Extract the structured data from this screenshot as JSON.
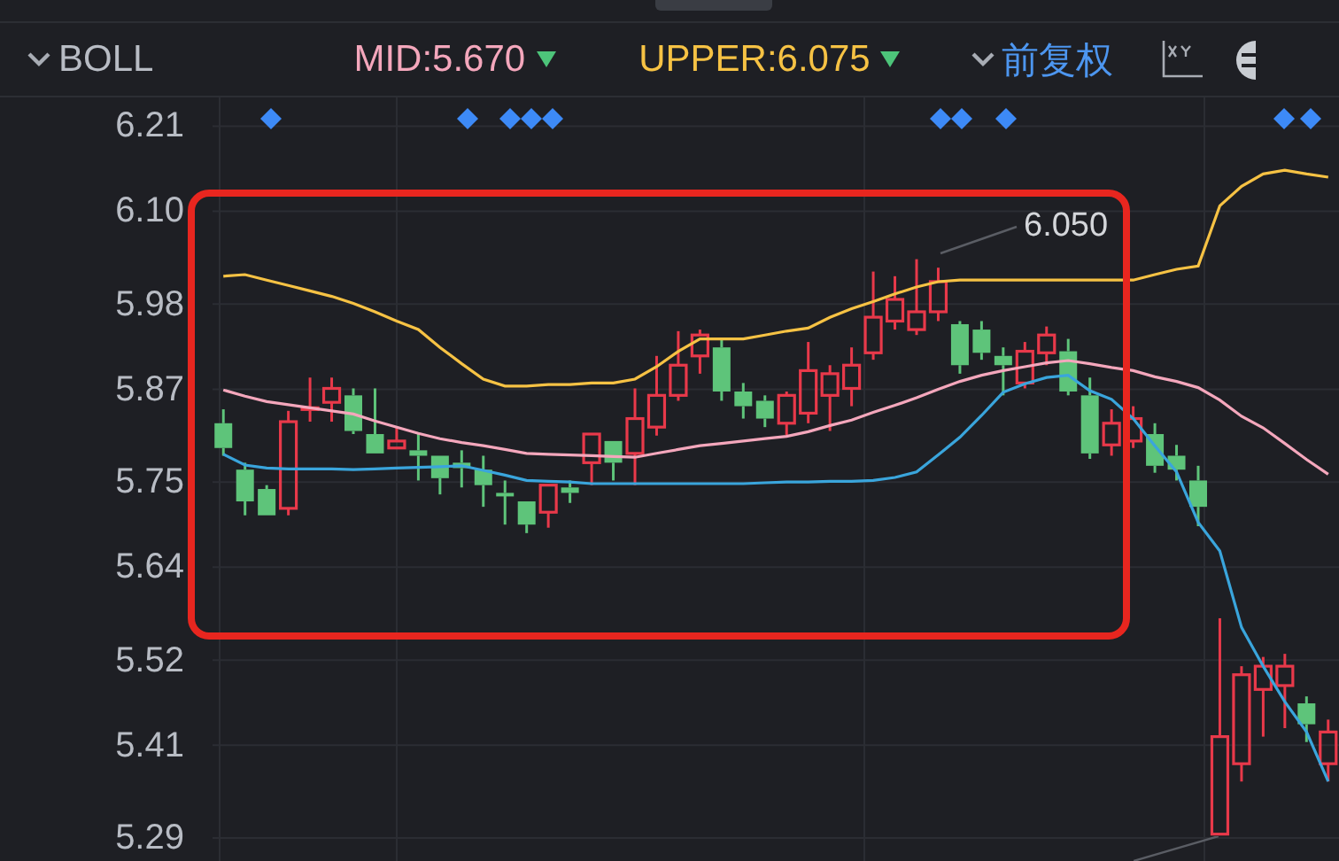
{
  "indicator": {
    "label": "BOLL"
  },
  "readouts": [
    {
      "label": "MID:5.670",
      "color": "#f4a7bc"
    },
    {
      "label": "UPPER:6.075",
      "color": "#f6c244"
    }
  ],
  "adjustment": {
    "label": "前复权"
  },
  "chart": {
    "chart_data": {
      "type": "candlestick",
      "categories": [
        null,
        null,
        null,
        null,
        null,
        null,
        null,
        null,
        null,
        null,
        null,
        null,
        null,
        null,
        null,
        null,
        null,
        null,
        null,
        null,
        null,
        null,
        null,
        null,
        null,
        null,
        null,
        null,
        null,
        null,
        null,
        null,
        null,
        null,
        null,
        null,
        null,
        null,
        null,
        null,
        null,
        null,
        null,
        null,
        null,
        null,
        null,
        null,
        null,
        null,
        null,
        null
      ],
      "ylim": [
        5.258,
        6.247
      ],
      "grid": true,
      "yticks": [
        {
          "value": 6.21,
          "label": "6.21"
        },
        {
          "value": 6.1,
          "label": "6.10"
        },
        {
          "value": 5.98,
          "label": "5.98"
        },
        {
          "value": 5.87,
          "label": "5.87"
        },
        {
          "value": 5.75,
          "label": "5.75"
        },
        {
          "value": 5.64,
          "label": "5.64"
        },
        {
          "value": 5.52,
          "label": "5.52"
        },
        {
          "value": 5.41,
          "label": "5.41"
        },
        {
          "value": 5.29,
          "label": "5.29"
        }
      ],
      "ohlc": [
        [
          5.826,
          5.844,
          5.784,
          5.794
        ],
        [
          5.766,
          5.775,
          5.707,
          5.725
        ],
        [
          5.741,
          5.746,
          5.707,
          5.707
        ],
        [
          5.716,
          5.842,
          5.707,
          5.828
        ],
        [
          5.844,
          5.885,
          5.828,
          5.846
        ],
        [
          5.853,
          5.885,
          5.828,
          5.871
        ],
        [
          5.862,
          5.871,
          5.812,
          5.816
        ],
        [
          5.812,
          5.871,
          5.787,
          5.787
        ],
        [
          5.794,
          5.821,
          5.794,
          5.803
        ],
        [
          5.791,
          5.812,
          5.752,
          5.784
        ],
        [
          5.784,
          5.784,
          5.734,
          5.755
        ],
        [
          5.775,
          5.791,
          5.743,
          5.768
        ],
        [
          5.766,
          5.784,
          5.718,
          5.746
        ],
        [
          5.736,
          5.752,
          5.695,
          5.732
        ],
        [
          5.725,
          5.725,
          5.684,
          5.695
        ],
        [
          5.711,
          5.746,
          5.691,
          5.746
        ],
        [
          5.743,
          5.752,
          5.723,
          5.736
        ],
        [
          5.775,
          5.812,
          5.746,
          5.812
        ],
        [
          5.803,
          5.803,
          5.752,
          5.775
        ],
        [
          5.787,
          5.871,
          5.746,
          5.832
        ],
        [
          5.821,
          5.913,
          5.81,
          5.862
        ],
        [
          5.862,
          5.945,
          5.855,
          5.901
        ],
        [
          5.913,
          5.947,
          5.89,
          5.94
        ],
        [
          5.924,
          5.935,
          5.855,
          5.867
        ],
        [
          5.867,
          5.878,
          5.832,
          5.848
        ],
        [
          5.855,
          5.862,
          5.821,
          5.832
        ],
        [
          5.826,
          5.867,
          5.81,
          5.862
        ],
        [
          5.839,
          5.931,
          5.826,
          5.894
        ],
        [
          5.862,
          5.901,
          5.816,
          5.89
        ],
        [
          5.871,
          5.924,
          5.848,
          5.901
        ],
        [
          5.917,
          6.022,
          5.908,
          5.963
        ],
        [
          5.958,
          6.016,
          5.947,
          5.986
        ],
        [
          5.947,
          6.038,
          5.94,
          5.97
        ],
        [
          5.97,
          6.027,
          5.958,
          6.009
        ],
        [
          5.954,
          5.958,
          5.89,
          5.901
        ],
        [
          5.947,
          5.958,
          5.908,
          5.917
        ],
        [
          5.913,
          5.924,
          5.862,
          5.901
        ],
        [
          5.878,
          5.931,
          5.871,
          5.919
        ],
        [
          5.917,
          5.951,
          5.901,
          5.94
        ],
        [
          5.919,
          5.935,
          5.862,
          5.867
        ],
        [
          5.862,
          5.885,
          5.78,
          5.787
        ],
        [
          5.798,
          5.844,
          5.784,
          5.826
        ],
        [
          5.803,
          5.848,
          5.794,
          5.832
        ],
        [
          5.812,
          5.826,
          5.762,
          5.771
        ],
        [
          5.784,
          5.798,
          5.752,
          5.766
        ],
        [
          5.752,
          5.771,
          5.693,
          5.718
        ],
        [
          5.295,
          5.574,
          5.295,
          5.421
        ],
        [
          5.386,
          5.512,
          5.363,
          5.501
        ],
        [
          5.482,
          5.524,
          5.421,
          5.512
        ],
        [
          5.487,
          5.528,
          5.432,
          5.512
        ],
        [
          5.464,
          5.473,
          5.414,
          5.437
        ],
        [
          5.386,
          5.443,
          5.363,
          5.427
        ]
      ],
      "series": [
        {
          "type": "line",
          "color": "#f6c244",
          "values": [
            6.016,
            6.018,
            6.011,
            6.004,
            5.997,
            5.99,
            5.981,
            5.97,
            5.958,
            5.947,
            5.924,
            5.903,
            5.883,
            5.874,
            5.874,
            5.876,
            5.876,
            5.878,
            5.878,
            5.883,
            5.899,
            5.919,
            5.935,
            5.935,
            5.935,
            5.94,
            5.945,
            5.949,
            5.963,
            5.974,
            5.983,
            5.993,
            6.002,
            6.009,
            6.011,
            6.011,
            6.011,
            6.011,
            6.011,
            6.011,
            6.011,
            6.011,
            6.011,
            6.018,
            6.025,
            6.029,
            6.107,
            6.132,
            6.148,
            6.153,
            6.148,
            6.144
          ]
        },
        {
          "type": "line",
          "color": "#f4a7bc",
          "values": [
            5.869,
            5.861,
            5.854,
            5.85,
            5.846,
            5.842,
            5.838,
            5.829,
            5.821,
            5.813,
            5.806,
            5.801,
            5.797,
            5.792,
            5.787,
            5.786,
            5.785,
            5.784,
            5.783,
            5.782,
            5.787,
            5.792,
            5.797,
            5.8,
            5.803,
            5.806,
            5.809,
            5.815,
            5.823,
            5.83,
            5.84,
            5.849,
            5.859,
            5.87,
            5.88,
            5.888,
            5.894,
            5.899,
            5.904,
            5.907,
            5.903,
            5.898,
            5.894,
            5.886,
            5.88,
            5.872,
            5.856,
            5.835,
            5.82,
            5.8,
            5.779,
            5.76
          ]
        },
        {
          "type": "line",
          "color": "#3aa5dc",
          "values": [
            5.786,
            5.772,
            5.768,
            5.767,
            5.767,
            5.767,
            5.766,
            5.767,
            5.768,
            5.769,
            5.77,
            5.771,
            5.765,
            5.759,
            5.752,
            5.751,
            5.75,
            5.748,
            5.748,
            5.748,
            5.748,
            5.748,
            5.748,
            5.748,
            5.748,
            5.749,
            5.75,
            5.75,
            5.751,
            5.751,
            5.752,
            5.756,
            5.763,
            5.785,
            5.808,
            5.836,
            5.866,
            5.877,
            5.885,
            5.888,
            5.868,
            5.857,
            5.832,
            5.797,
            5.763,
            5.698,
            5.661,
            5.562,
            5.512,
            5.466,
            5.427,
            5.363
          ]
        }
      ],
      "annotations": [
        {
          "text": "6.050"
        }
      ]
    }
  }
}
